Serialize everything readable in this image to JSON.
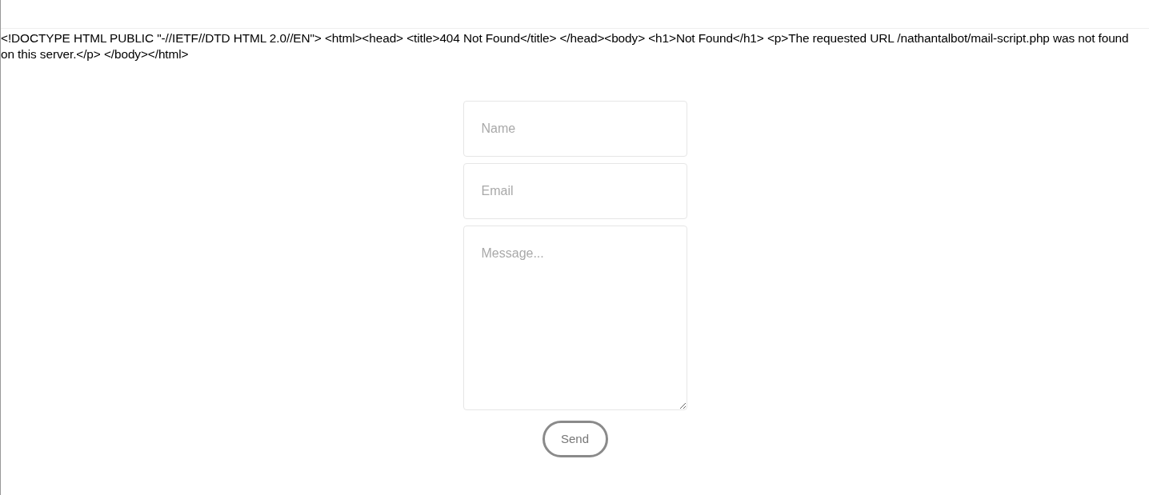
{
  "error_text": "<!DOCTYPE HTML PUBLIC \"-//IETF//DTD HTML 2.0//EN\"> <html><head> <title>404 Not Found</title> </head><body> <h1>Not Found</h1> <p>The requested URL /nathantalbot/mail-script.php was not found on this server.</p> </body></html>",
  "form": {
    "fields": [
      {
        "kind": "input",
        "placeholder": "Name"
      },
      {
        "kind": "input",
        "placeholder": "Email"
      },
      {
        "kind": "textarea",
        "placeholder": "Message..."
      }
    ],
    "button": "Send"
  }
}
